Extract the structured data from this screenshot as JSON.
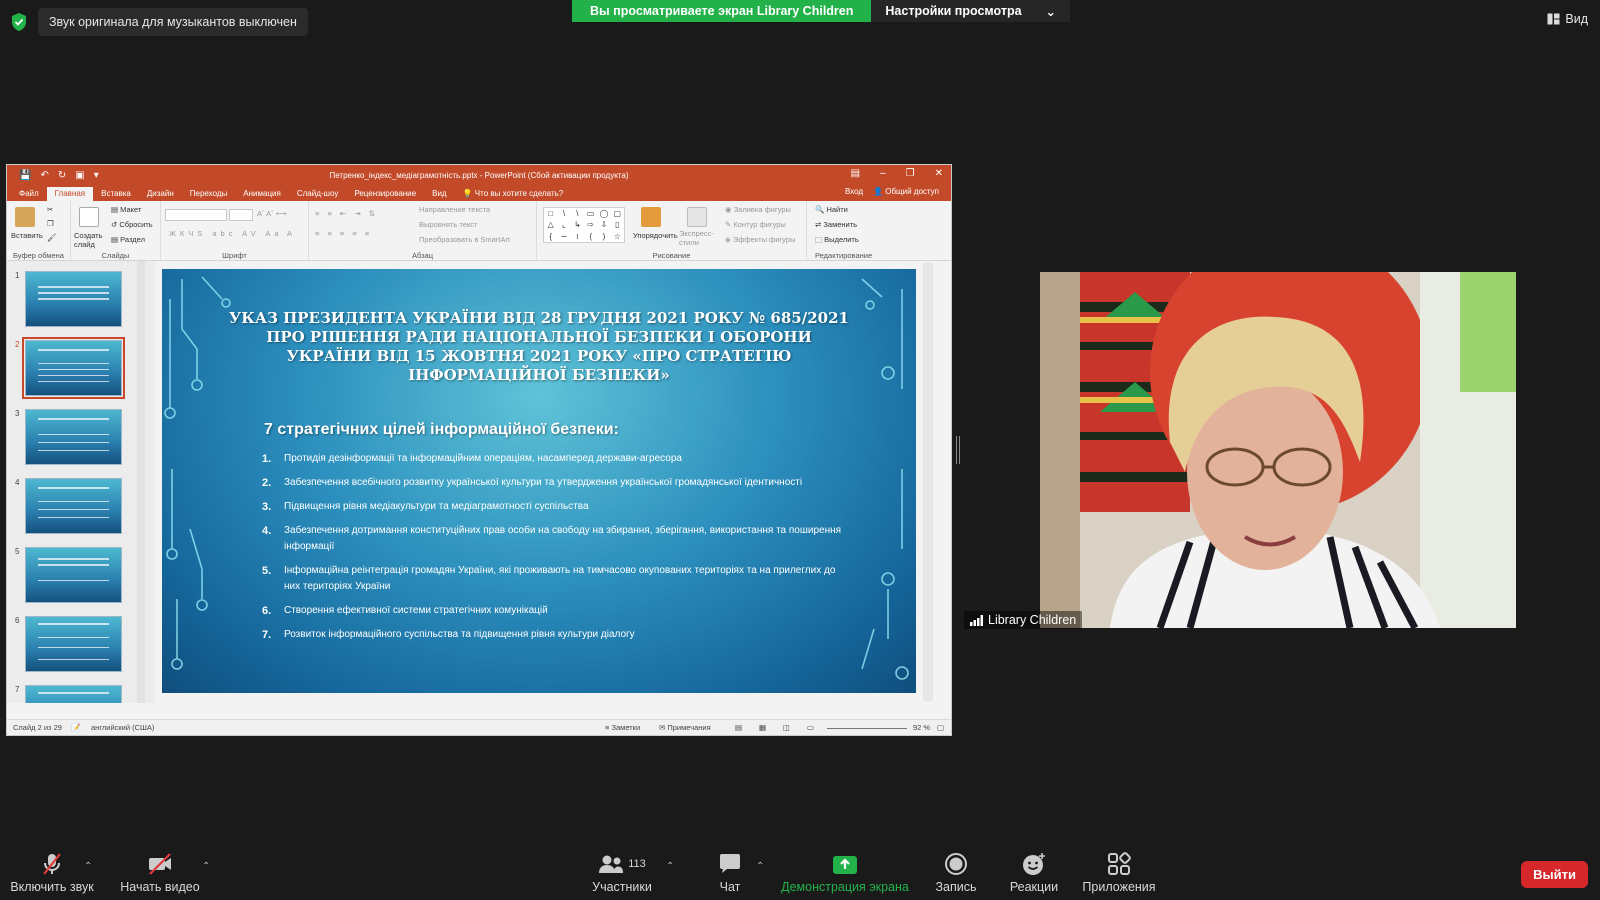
{
  "zoom": {
    "notice": "Звук оригинала для музыкантов выключен",
    "share_banner": "Вы просматриваете экран Library Children",
    "view_options": "Настройки просмотра",
    "view_button": "Вид",
    "participant_name": "Library Children",
    "toolbar": {
      "unmute": "Включить звук",
      "start_video": "Начать видео",
      "participants": "Участники",
      "participants_count": "113",
      "chat": "Чат",
      "share_screen": "Демонстрация экрана",
      "record": "Запись",
      "reactions": "Реакции",
      "apps": "Приложения",
      "leave": "Выйти"
    },
    "colors": {
      "share_green": "#23b24a",
      "leave_red": "#d6272a"
    }
  },
  "ppt": {
    "title": "Петренко_індекс_медіаграмотність.pptx - PowerPoint (Сбой активации продукта)",
    "tabs": [
      "Файл",
      "Главная",
      "Вставка",
      "Дизайн",
      "Переходы",
      "Анимация",
      "Слайд-шоу",
      "Рецензирование",
      "Вид",
      "Что вы хотите сделать?"
    ],
    "active_tab": "Главная",
    "signin": "Вход",
    "share": "Общий доступ",
    "ribbon": {
      "clipboard": {
        "paste": "Вставить",
        "label": "Буфер обмена"
      },
      "slides": {
        "create": "Создать слайд",
        "layout": "Макет",
        "reset": "Сбросить",
        "section": "Раздел",
        "label": "Слайды"
      },
      "font": {
        "label": "Шрифт"
      },
      "paragraph": {
        "text_direction": "Направление текста",
        "align_text": "Выровнять текст",
        "smartart": "Преобразовать в SmartArt",
        "label": "Абзац"
      },
      "drawing": {
        "arrange": "Упорядочить",
        "quick_styles": "Экспресс-стили",
        "fill": "Заливка фигуры",
        "outline": "Контур фигуры",
        "effects": "Эффекты фигуры",
        "label": "Рисование"
      },
      "editing": {
        "find": "Найти",
        "replace": "Заменить",
        "select": "Выделить",
        "label": "Редактирование"
      }
    },
    "thumbnails": [
      "1",
      "2",
      "3",
      "4",
      "5",
      "6",
      "7"
    ],
    "selected_slide": 2,
    "status": {
      "slide_of": "Слайд 2 из 29",
      "language": "английский (США)",
      "notes": "Заметки",
      "comments": "Примечания",
      "zoom": "92 %"
    },
    "slide": {
      "title": "УКАЗ ПРЕЗИДЕНТА УКРАЇНИ ВІД 28 ГРУДНЯ 2021 РОКУ № 685/2021 ПРО РІШЕННЯ РАДИ НАЦІОНАЛЬНОЇ БЕЗПЕКИ І ОБОРОНИ УКРАЇНИ ВІД 15 ЖОВТНЯ 2021 РОКУ «ПРО СТРАТЕГІЮ ІНФОРМАЦІЙНОЇ БЕЗПЕКИ»",
      "subtitle": "7 стратегічних цілей інформаційної безпеки:",
      "items": [
        {
          "num": "1.",
          "text": "Протидія дезінформації та інформаційним операціям, насамперед держави-агресора"
        },
        {
          "num": "2.",
          "text": "Забезпечення всебічного розвитку української культури та утвердження української громадянської ідентичності"
        },
        {
          "num": "3.",
          "text": "Підвищення рівня медіакультури та медіаграмотності суспільства"
        },
        {
          "num": "4.",
          "text": "Забезпечення дотримання конституційних прав особи на свободу на збирання, зберігання, використання та поширення інформації"
        },
        {
          "num": "5.",
          "text": "Інформаційна реінтеграція громадян України, які проживають на тимчасово окупованих територіях та на прилеглих до них територіях України"
        },
        {
          "num": "6.",
          "text": "Створення ефективної системи стратегічних комунікацій"
        },
        {
          "num": "7.",
          "text": "Розвиток інформаційного суспільства та підвищення рівня культури діалогу"
        }
      ]
    }
  }
}
